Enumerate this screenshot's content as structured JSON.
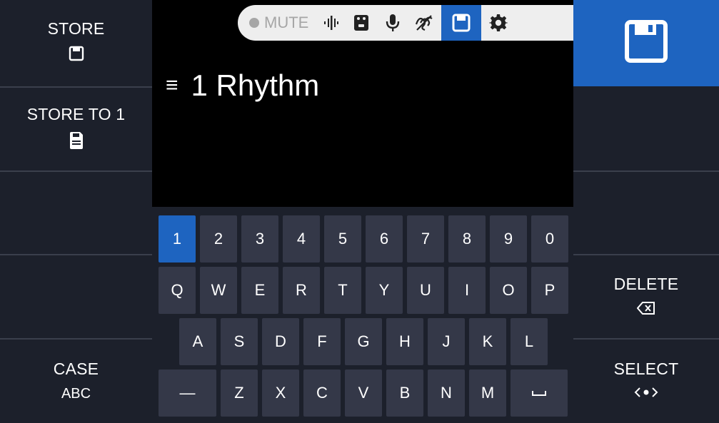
{
  "left_panel": {
    "store": {
      "label": "STORE"
    },
    "store_to": {
      "label": "STORE TO 1"
    },
    "case": {
      "label": "CASE",
      "sub": "ABC"
    }
  },
  "right_panel": {
    "delete": {
      "label": "DELETE"
    },
    "select": {
      "label": "SELECT"
    }
  },
  "toolbar": {
    "mute_label": "MUTE",
    "icons": [
      "tuner-icon",
      "effect-pedal-icon",
      "microphone-icon",
      "looper-icon",
      "save-icon",
      "settings-icon"
    ],
    "active_icon": "save-icon"
  },
  "patch": {
    "name": "1 Rhythm"
  },
  "keyboard": {
    "row1": [
      "1",
      "2",
      "3",
      "4",
      "5",
      "6",
      "7",
      "8",
      "9",
      "0"
    ],
    "row2": [
      "Q",
      "W",
      "E",
      "R",
      "T",
      "Y",
      "U",
      "I",
      "O",
      "P"
    ],
    "row3": [
      "A",
      "S",
      "D",
      "F",
      "G",
      "H",
      "J",
      "K",
      "L"
    ],
    "row4_letters": [
      "Z",
      "X",
      "C",
      "V",
      "B",
      "N",
      "M"
    ],
    "dash": "—",
    "selected_key": "1"
  },
  "colors": {
    "accent": "#1e64c0",
    "background": "#1c202b",
    "key": "#343848",
    "toolbar": "#eeeeee"
  }
}
